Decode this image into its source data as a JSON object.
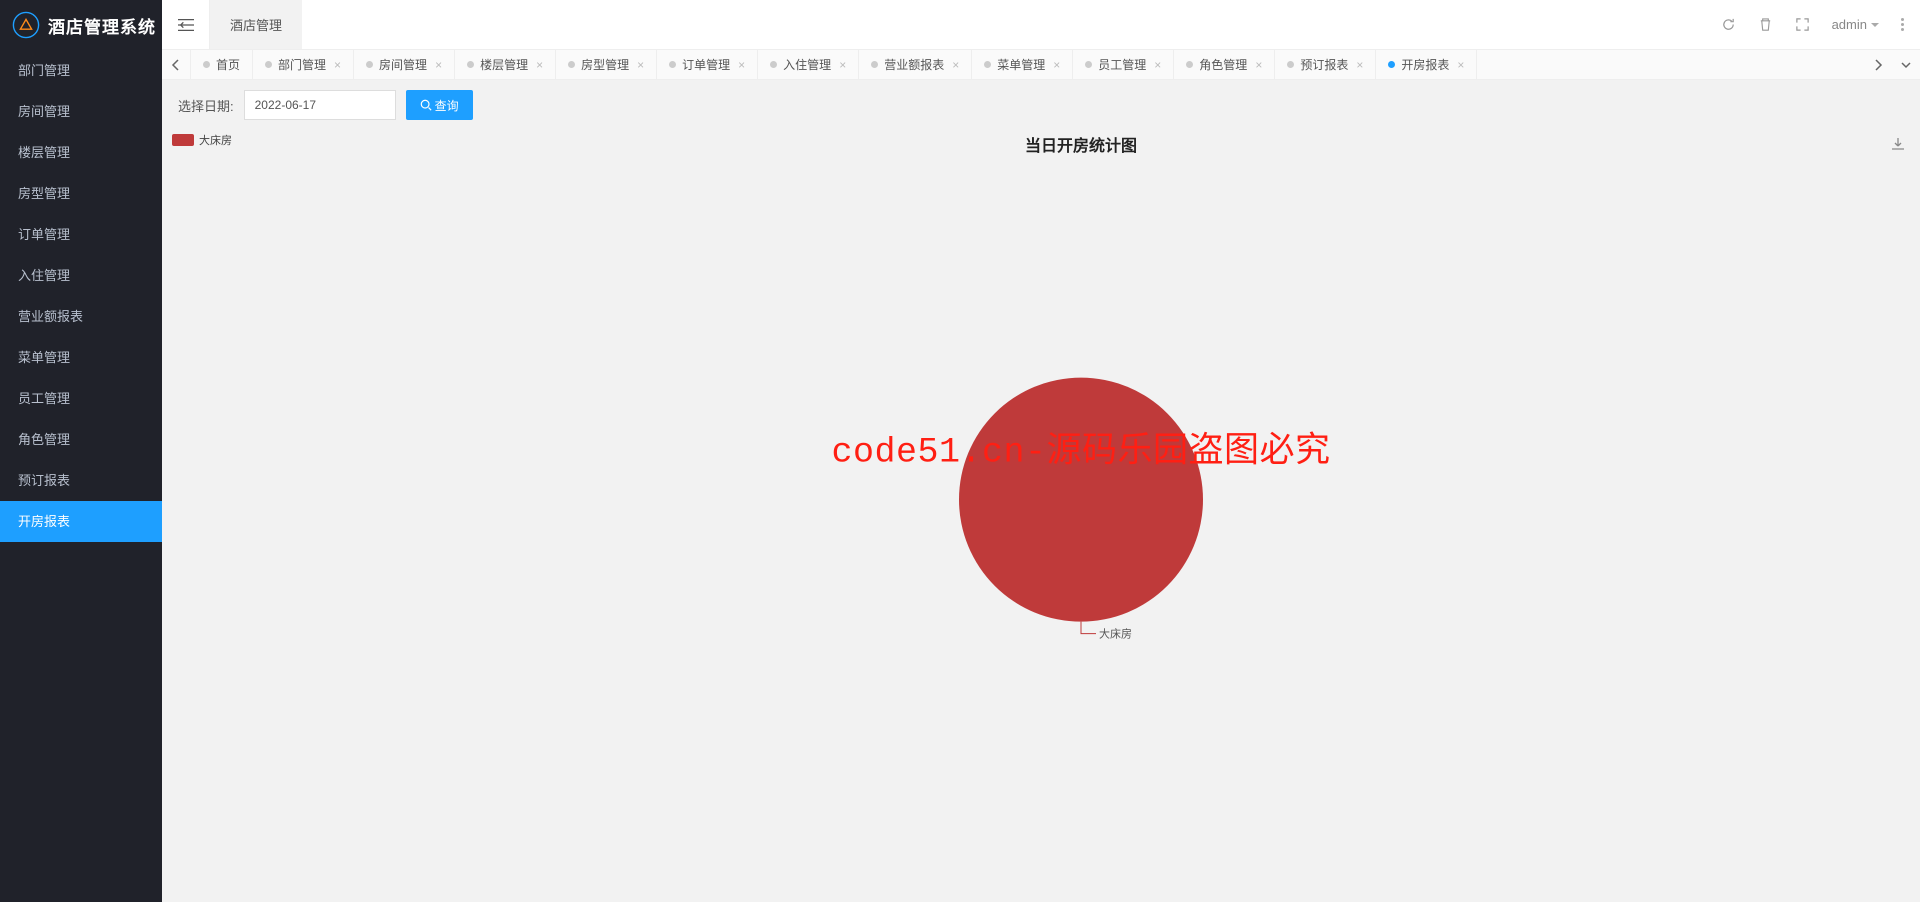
{
  "app": {
    "title": "酒店管理系统"
  },
  "sidebar": {
    "items": [
      {
        "label": "部门管理"
      },
      {
        "label": "房间管理"
      },
      {
        "label": "楼层管理"
      },
      {
        "label": "房型管理"
      },
      {
        "label": "订单管理"
      },
      {
        "label": "入住管理"
      },
      {
        "label": "营业额报表"
      },
      {
        "label": "菜单管理"
      },
      {
        "label": "员工管理"
      },
      {
        "label": "角色管理"
      },
      {
        "label": "预订报表"
      },
      {
        "label": "开房报表"
      }
    ],
    "active_index": 11
  },
  "header": {
    "tab_label": "酒店管理",
    "user": "admin"
  },
  "tabs": {
    "items": [
      {
        "label": "首页",
        "closable": false
      },
      {
        "label": "部门管理",
        "closable": true
      },
      {
        "label": "房间管理",
        "closable": true
      },
      {
        "label": "楼层管理",
        "closable": true
      },
      {
        "label": "房型管理",
        "closable": true
      },
      {
        "label": "订单管理",
        "closable": true
      },
      {
        "label": "入住管理",
        "closable": true
      },
      {
        "label": "营业额报表",
        "closable": true
      },
      {
        "label": "菜单管理",
        "closable": true
      },
      {
        "label": "员工管理",
        "closable": true
      },
      {
        "label": "角色管理",
        "closable": true
      },
      {
        "label": "预订报表",
        "closable": true
      },
      {
        "label": "开房报表",
        "closable": true
      }
    ],
    "active_index": 12
  },
  "filter": {
    "label": "选择日期:",
    "date_value": "2022-06-17",
    "query_label": "查询"
  },
  "chart_data": {
    "type": "pie",
    "title": "当日开房统计图",
    "series": [
      {
        "name": "大床房",
        "value": 1,
        "color": "#bf3a3a"
      }
    ],
    "legend_position": "left",
    "label": "大床房"
  },
  "watermark": "code51.cn-源码乐园盗图必究"
}
